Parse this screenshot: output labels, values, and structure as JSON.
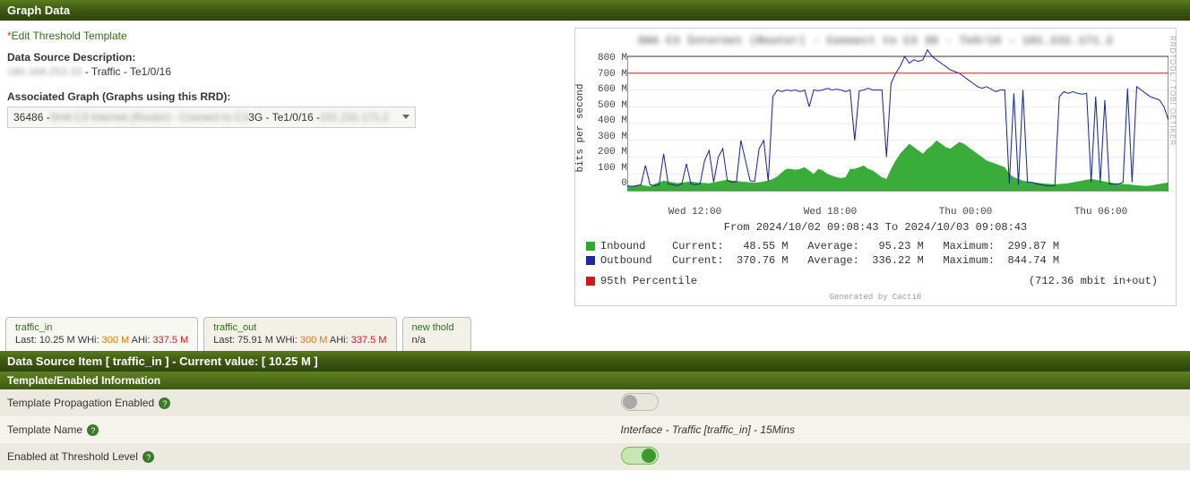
{
  "header": {
    "title": "Graph Data"
  },
  "edit_link": {
    "star": "*",
    "text": "Edit Threshold Template"
  },
  "ds_description": {
    "label": "Data Source Description:",
    "value_hidden": "180.169.253.33",
    "value_rest": " - Traffic - Te1/0/16"
  },
  "assoc_graph": {
    "label": "Associated Graph (Graphs using this RRD):",
    "select_id": "36486 - ",
    "select_hidden_a": "SHA C3 Internet (Router) - Connect to C3",
    "select_mid": " 3G - Te1/0/16 - ",
    "select_hidden_b": "101.231.171.2"
  },
  "chart": {
    "type": "line+area",
    "title_hidden": "SHA C3 Internet (Router) - Connect to C3 3G - Te0/16 - 101.231.171.2",
    "ylabel": "bits per second",
    "ymin": 0,
    "ymax": 800,
    "yunit": "M",
    "yticks": [
      "800 M",
      "700 M",
      "600 M",
      "500 M",
      "400 M",
      "300 M",
      "200 M",
      "100 M",
      "0"
    ],
    "xticks": [
      "Wed 12:00",
      "Wed 18:00",
      "Thu 00:00",
      "Thu 06:00"
    ],
    "threshold_line": 700,
    "range_text": "From 2024/10/02 09:08:43 To 2024/10/03 09:08:43",
    "watermark": "RRDTOOL / TOBI OETIKER",
    "gen_by": "Generated by Cacti®",
    "legend": {
      "inbound": {
        "label": "Inbound",
        "cur_lbl": "Current:",
        "cur": "48.55 M",
        "avg_lbl": "Average:",
        "avg": "95.23 M",
        "max_lbl": "Maximum:",
        "max": "299.87 M"
      },
      "outbound": {
        "label": "Outbound",
        "cur_lbl": "Current:",
        "cur": "370.76 M",
        "avg_lbl": "Average:",
        "avg": "336.22 M",
        "max_lbl": "Maximum:",
        "max": "844.74 M"
      },
      "pct95": {
        "label": "95th Percentile",
        "note": "(712.36 mbit in+out)"
      }
    }
  },
  "tabs": [
    {
      "name": "traffic_in",
      "last_lbl": "Last:",
      "last": "10.25 M",
      "whi_lbl": "WHi:",
      "whi": "300 M",
      "ahi_lbl": "AHi:",
      "ahi": "337.5 M"
    },
    {
      "name": "traffic_out",
      "last_lbl": "Last:",
      "last": "75.91 M",
      "whi_lbl": "WHi:",
      "whi": "300 M",
      "ahi_lbl": "AHi:",
      "ahi": "337.5 M"
    },
    {
      "name": "new thold",
      "na": "n/a"
    }
  ],
  "ds_item_bar": "Data Source Item [ traffic_in ] - Current value: [ 10.25 M ]",
  "sub_header": "Template/Enabled Information",
  "settings": [
    {
      "label": "Template Propagation Enabled",
      "type": "toggle",
      "on": false
    },
    {
      "label": "Template Name",
      "type": "text",
      "value": "Interface - Traffic [traffic_in] - 15Mins"
    },
    {
      "label": "Enabled at Threshold Level",
      "type": "toggle",
      "on": true
    }
  ],
  "chart_data": {
    "type": "line+area",
    "x_count": 120,
    "ylim": [
      0,
      800
    ],
    "yunit": "M",
    "threshold": 700,
    "series": [
      {
        "name": "Inbound",
        "style": "area",
        "color": "#2ea82e",
        "values": [
          30,
          28,
          32,
          35,
          30,
          25,
          40,
          50,
          60,
          55,
          50,
          45,
          48,
          52,
          55,
          50,
          48,
          46,
          44,
          50,
          55,
          60,
          65,
          60,
          58,
          55,
          52,
          50,
          48,
          50,
          55,
          60,
          70,
          85,
          110,
          130,
          130,
          125,
          130,
          140,
          120,
          100,
          130,
          120,
          100,
          90,
          80,
          75,
          80,
          130,
          130,
          140,
          150,
          130,
          120,
          100,
          80,
          70,
          130,
          180,
          220,
          250,
          280,
          260,
          240,
          220,
          250,
          270,
          300,
          280,
          260,
          250,
          270,
          290,
          280,
          260,
          240,
          220,
          200,
          180,
          170,
          160,
          150,
          140,
          100,
          80,
          70,
          60,
          55,
          50,
          48,
          45,
          42,
          40,
          38,
          40,
          42,
          45,
          50,
          55,
          60,
          65,
          70,
          65,
          60,
          55,
          50,
          45,
          42,
          40,
          38,
          35,
          32,
          30,
          28,
          30,
          35,
          40,
          45,
          50
        ]
      },
      {
        "name": "Outbound",
        "style": "line",
        "color": "#1a2a9a",
        "values": [
          30,
          25,
          30,
          35,
          150,
          35,
          30,
          35,
          220,
          40,
          35,
          30,
          40,
          160,
          40,
          35,
          40,
          180,
          240,
          50,
          200,
          250,
          60,
          50,
          55,
          300,
          180,
          60,
          55,
          250,
          300,
          55,
          560,
          600,
          590,
          600,
          595,
          600,
          590,
          600,
          500,
          600,
          595,
          600,
          610,
          600,
          605,
          600,
          590,
          600,
          300,
          595,
          600,
          610,
          600,
          600,
          600,
          200,
          640,
          700,
          740,
          800,
          760,
          780,
          770,
          780,
          840,
          800,
          780,
          760,
          740,
          720,
          710,
          700,
          680,
          660,
          640,
          620,
          610,
          620,
          605,
          590,
          600,
          600,
          40,
          580,
          35,
          600,
          50,
          50,
          40,
          35,
          30,
          28,
          30,
          560,
          590,
          580,
          590,
          580,
          575,
          580,
          50,
          560,
          50,
          540,
          40,
          40,
          40,
          50,
          610,
          50,
          620,
          600,
          580,
          560,
          550,
          540,
          500,
          420
        ]
      }
    ]
  }
}
